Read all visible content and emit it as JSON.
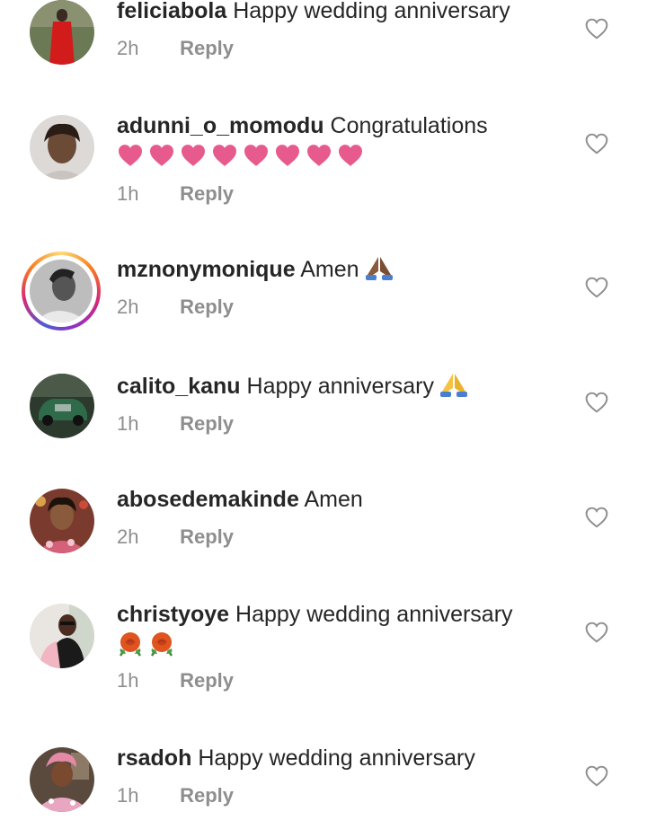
{
  "comments": [
    {
      "username": "feliciabola",
      "text": "Happy wedding anniversary",
      "time": "2h",
      "reply": "Reply"
    },
    {
      "username": "adunni_o_momodu",
      "text": "Congratulations",
      "time": "1h",
      "reply": "Reply",
      "emoji": "pink-heart-x8"
    },
    {
      "username": "mznonymonique",
      "text": "Amen",
      "time": "2h",
      "reply": "Reply",
      "emoji": "folded-hands-medium-dark"
    },
    {
      "username": "calito_kanu",
      "text": "Happy anniversary",
      "time": "1h",
      "reply": "Reply",
      "emoji": "folded-hands"
    },
    {
      "username": "abosedemakinde",
      "text": "Amen",
      "time": "2h",
      "reply": "Reply"
    },
    {
      "username": "christyoye",
      "text": "Happy wedding anniversary",
      "time": "1h",
      "reply": "Reply",
      "emoji": "rose-x2"
    },
    {
      "username": "rsadoh",
      "text": "Happy wedding anniversary",
      "time": "1h",
      "reply": "Reply"
    }
  ],
  "icons": {
    "like": "heart-outline-icon"
  },
  "colors": {
    "text": "#262626",
    "meta": "#8e8e8e",
    "heart_emoji": "#e75a8d"
  }
}
